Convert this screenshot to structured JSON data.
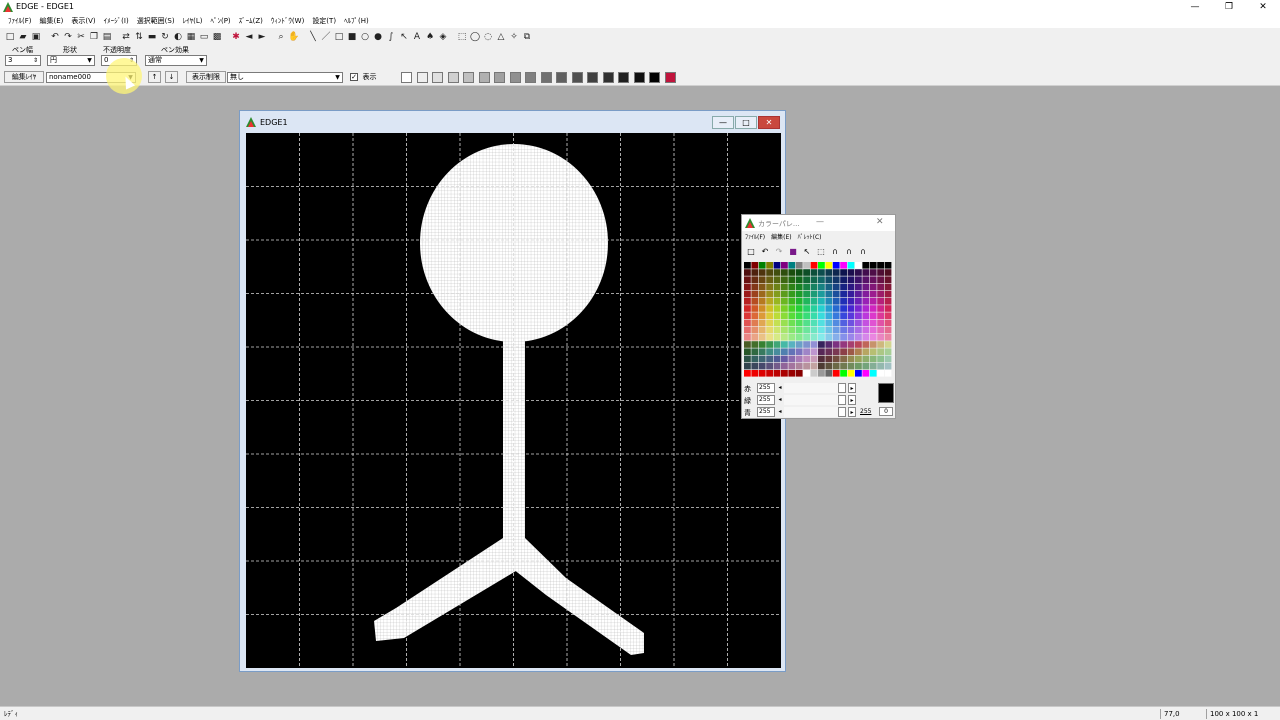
{
  "app": {
    "title": "EDGE - EDGE1",
    "window_controls": [
      "—",
      "❐",
      "✕"
    ]
  },
  "menu": [
    "ﾌｧｲﾙ(F)",
    "編集(E)",
    "表示(V)",
    "ｲﾒｰｼﾞ(I)",
    "選択範囲(S)",
    "ﾚｲﾔ(L)",
    "ﾍﾟﾝ(P)",
    "ｽﾞｰﾑ(Z)",
    "ｳｨﾝﾄﾞｳ(W)",
    "設定(T)",
    "ﾍﾙﾌﾟ(H)"
  ],
  "pen_settings": {
    "width_label": "ペン幅",
    "width_value": "3",
    "shape_label": "形状",
    "shape_value": "円",
    "opacity_label": "不透明度",
    "opacity_value": "0",
    "effect_label": "ペン効果",
    "effect_value": "通常"
  },
  "layer_bar": {
    "edit_layer_label": "編集ﾚｲﾔ",
    "layer_value": "noname000",
    "up_label": "↑",
    "down_label": "↓",
    "display_limit_label": "表示制限",
    "display_limit_value": "無し",
    "show_checkbox_label": "表示",
    "show_checked": true
  },
  "document": {
    "title": "EDGE1",
    "controls": [
      "—",
      "□",
      "✕"
    ]
  },
  "palette": {
    "title": "カラーパレ...",
    "minimize": "—",
    "close": "✕",
    "menu": [
      "ﾌｧｲﾙ(F)",
      "編集(E)",
      "ﾊﾟﾚｯﾄ(C)"
    ],
    "red_label": "赤",
    "green_label": "緑",
    "blue_label": "青",
    "red_value": "255",
    "green_value": "255",
    "blue_value": "255",
    "alpha_value": "255",
    "index_value": "0",
    "current_color": "#000000"
  },
  "status": {
    "left": "ﾚﾃﾞｨ",
    "coords": "77,0",
    "size": "100 x 100 x 1"
  },
  "colors": {
    "background": "#ababab",
    "canvas": "#000000",
    "drawing": "#ffffff",
    "accent": "#c0143c"
  }
}
